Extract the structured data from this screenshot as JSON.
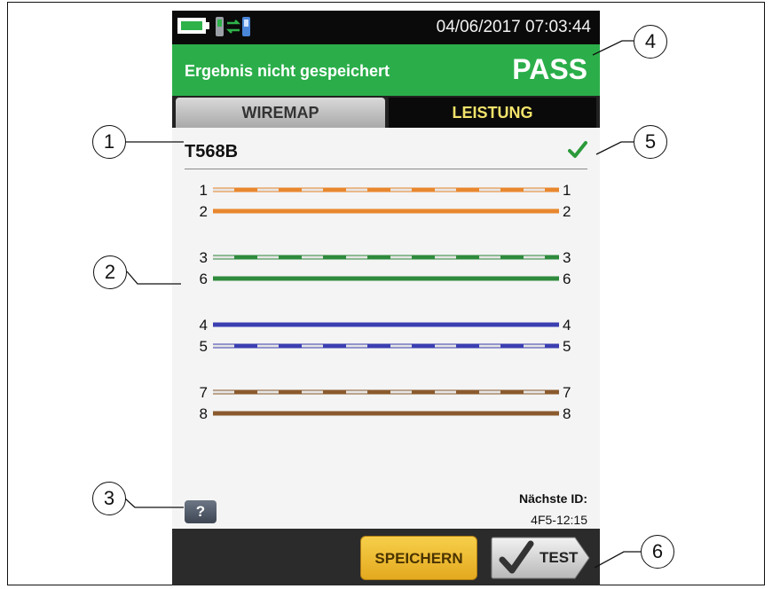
{
  "status_bar": {
    "datetime": "04/06/2017 07:03:44"
  },
  "header": {
    "message": "Ergebnis nicht gespeichert",
    "status": "PASS",
    "color": "#2bae4a"
  },
  "tabs": [
    {
      "label": "WIREMAP"
    },
    {
      "label": "LEISTUNG",
      "active": true
    }
  ],
  "test_standard": "T568B",
  "wiremap": {
    "groups": [
      {
        "color": "#e8872e",
        "wires": [
          {
            "pin": "1",
            "striped": true
          },
          {
            "pin": "2",
            "striped": false
          }
        ]
      },
      {
        "color": "#2e8a3c",
        "wires": [
          {
            "pin": "3",
            "striped": true
          },
          {
            "pin": "6",
            "striped": false
          }
        ]
      },
      {
        "color": "#3b3fb0",
        "wires": [
          {
            "pin": "4",
            "striped": false
          },
          {
            "pin": "5",
            "striped": true
          }
        ]
      },
      {
        "color": "#8a5a2e",
        "wires": [
          {
            "pin": "7",
            "striped": true
          },
          {
            "pin": "8",
            "striped": false
          }
        ]
      }
    ]
  },
  "help_label": "?",
  "next_id": {
    "label": "Nächste ID:",
    "value": "4F5-12:15"
  },
  "buttons": {
    "save_label": "SPEICHERN",
    "test_label": "TEST"
  },
  "callouts": [
    "1",
    "2",
    "3",
    "4",
    "5",
    "6"
  ],
  "icons": {
    "battery": "battery-icon",
    "devices": "tester-remote-icon",
    "check": "checkmark-icon",
    "help": "help-icon",
    "test": "checkmark-icon"
  }
}
